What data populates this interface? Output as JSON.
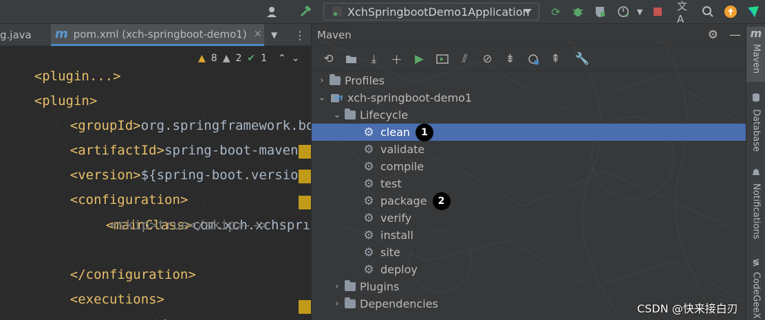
{
  "toolbar": {
    "run_config": "XchSpringbootDemo1Application",
    "icons": [
      "user-icon",
      "build-hammer-icon",
      "rerun-icon",
      "debug-bug-icon",
      "coverage-icon",
      "profiler-icon",
      "stop-icon",
      "translate-icon",
      "search-icon",
      "update-icon",
      "ide-logo-icon"
    ]
  },
  "editor": {
    "tabs": [
      {
        "label": "g.java"
      },
      {
        "label": "pom.xml (xch-springboot-demo1)",
        "active": true
      }
    ],
    "inspections": {
      "warnings": "8",
      "weak_warnings": "2",
      "ok": "1"
    },
    "lines": [
      {
        "open": "<",
        "tag": "plugin",
        "close": "...>",
        "text": ""
      },
      {
        "open": "<",
        "tag": "plugin",
        "close": ">",
        "text": ""
      },
      {
        "open": "<",
        "tag": "groupId",
        "close": ">",
        "text": "org.springframework.bo"
      },
      {
        "open": "<",
        "tag": "artifactId",
        "close": ">",
        "text": "spring-boot-maven-p"
      },
      {
        "open": "<",
        "tag": "version",
        "close": ">",
        "text": "${spring-boot.versio"
      },
      {
        "open": "<",
        "tag": "configuration",
        "close": ">",
        "text": ""
      },
      {
        "open": "<",
        "tag": "mainClass",
        "close": ">",
        "text": "com.xch.xchsprı"
      },
      {
        "comment": "<skip>true</skip>-->"
      },
      {
        "open": "</",
        "tag": "configuration",
        "close": ">",
        "text": ""
      },
      {
        "open": "<",
        "tag": "executions",
        "close": ">",
        "text": ""
      },
      {
        "open": "<",
        "tag": "execution",
        "close": ">",
        "text": ""
      }
    ]
  },
  "maven": {
    "title": "Maven",
    "toolbar_icons": [
      "reload-icon",
      "add-folder-icon",
      "download-icon",
      "plus-icon",
      "run-icon",
      "execute-goal-icon",
      "toggle-offline-icon",
      "skip-tests-icon",
      "collapse-icon",
      "show-deps-icon",
      "expand-icon",
      "settings-wrench-icon"
    ],
    "tree": {
      "profiles": "Profiles",
      "project": "xch-springboot-demo1",
      "lifecycle": "Lifecycle",
      "goals": [
        {
          "label": "clean",
          "badge": "1",
          "selected": true
        },
        {
          "label": "validate"
        },
        {
          "label": "compile"
        },
        {
          "label": "test"
        },
        {
          "label": "package",
          "badge": "2"
        },
        {
          "label": "verify"
        },
        {
          "label": "install"
        },
        {
          "label": "site"
        },
        {
          "label": "deploy"
        }
      ],
      "plugins": "Plugins",
      "dependencies": "Dependencies"
    }
  },
  "sidebar": {
    "tabs": [
      {
        "label": "Maven",
        "icon": "maven-m-icon"
      },
      {
        "label": "Database",
        "icon": "database-icon"
      },
      {
        "label": "Notifications",
        "icon": "bell-icon"
      },
      {
        "label": "CodeGeeX",
        "icon": "codegeex-icon"
      }
    ]
  },
  "watermark": "CSDN @快来接白刃"
}
